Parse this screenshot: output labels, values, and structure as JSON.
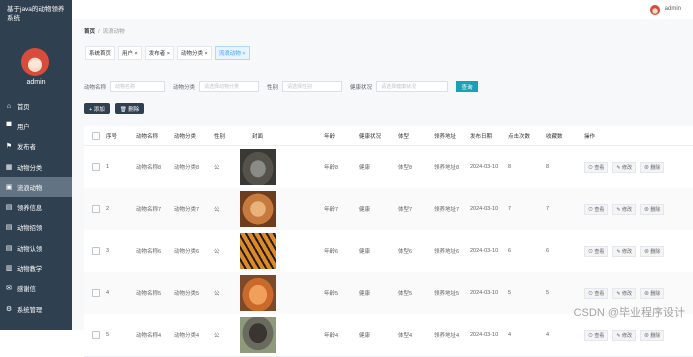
{
  "app": {
    "title": "基于java的动物领养系统"
  },
  "user": {
    "name": "admin"
  },
  "sidebar": {
    "items": [
      {
        "label": "首页",
        "icon": "home-icon",
        "glyph": "⌂"
      },
      {
        "label": "用户",
        "icon": "user-icon",
        "glyph": "▀"
      },
      {
        "label": "发布者",
        "icon": "flag-icon",
        "glyph": "⚑"
      },
      {
        "label": "动物分类",
        "icon": "grid-icon",
        "glyph": "▦"
      },
      {
        "label": "流浪动物",
        "icon": "paw-icon",
        "glyph": "▣"
      },
      {
        "label": "领养信息",
        "icon": "doc-icon",
        "glyph": "▤"
      },
      {
        "label": "动物招领",
        "icon": "doc-icon",
        "glyph": "▤"
      },
      {
        "label": "动物认领",
        "icon": "doc-icon",
        "glyph": "▤"
      },
      {
        "label": "动物教学",
        "icon": "book-icon",
        "glyph": "▥"
      },
      {
        "label": "感谢信",
        "icon": "mail-icon",
        "glyph": "✉"
      },
      {
        "label": "系统管理",
        "icon": "gear-icon",
        "glyph": "⚙"
      }
    ]
  },
  "breadcrumb": {
    "home": "首页",
    "current": "流浪动物"
  },
  "tabs": [
    {
      "label": "系统首页"
    },
    {
      "label": "用户 ×"
    },
    {
      "label": "发布者 ×"
    },
    {
      "label": "动物分类 ×"
    },
    {
      "label": "流浪动物 ×"
    }
  ],
  "search": {
    "name_label": "动物名称",
    "name_placeholder": "动物名称",
    "category_label": "动物分类",
    "category_placeholder": "请选择动物分类",
    "gender_label": "性别",
    "gender_placeholder": "请选择性别",
    "health_label": "健康状况",
    "health_placeholder": "请选择健康状况",
    "button": "查询"
  },
  "toolbar": {
    "add": "+ 添加",
    "delete": "🗑 删除"
  },
  "table": {
    "headers": [
      "序号",
      "动物名称",
      "动物分类",
      "性别",
      "封面",
      "年龄",
      "健康状况",
      "体型",
      "领养地址",
      "发布日期",
      "点击次数",
      "收藏数",
      "操作"
    ],
    "ops": {
      "view": "⊙ 查看",
      "edit": "✎ 修改",
      "delete": "⊗ 删除"
    },
    "rows": [
      {
        "no": "1",
        "name": "动物名称8",
        "category": "动物分类8",
        "gender": "公",
        "age": "年龄8",
        "health": "健康",
        "size": "体型8",
        "address": "领养地址8",
        "date": "2024-03-10",
        "clicks": "8",
        "favs": "8",
        "img": "bear"
      },
      {
        "no": "2",
        "name": "动物名称7",
        "category": "动物分类7",
        "gender": "公",
        "age": "年龄7",
        "health": "健康",
        "size": "体型7",
        "address": "领养地址7",
        "date": "2024-03-10",
        "clicks": "7",
        "favs": "7",
        "img": "cat"
      },
      {
        "no": "3",
        "name": "动物名称6",
        "category": "动物分类6",
        "gender": "公",
        "age": "年龄6",
        "health": "健康",
        "size": "体型6",
        "address": "领养地址6",
        "date": "2024-03-10",
        "clicks": "6",
        "favs": "6",
        "img": "tiger"
      },
      {
        "no": "4",
        "name": "动物名称5",
        "category": "动物分类5",
        "gender": "公",
        "age": "年龄5",
        "health": "健康",
        "size": "体型5",
        "address": "领养地址5",
        "date": "2024-03-10",
        "clicks": "5",
        "favs": "5",
        "img": "cat2"
      },
      {
        "no": "5",
        "name": "动物名称4",
        "category": "动物分类4",
        "gender": "公",
        "age": "年龄4",
        "health": "健康",
        "size": "体型4",
        "address": "领养地址4",
        "date": "2024-03-10",
        "clicks": "4",
        "favs": "4",
        "img": "dog"
      }
    ]
  },
  "watermark": "CSDN @毕业程序设计"
}
